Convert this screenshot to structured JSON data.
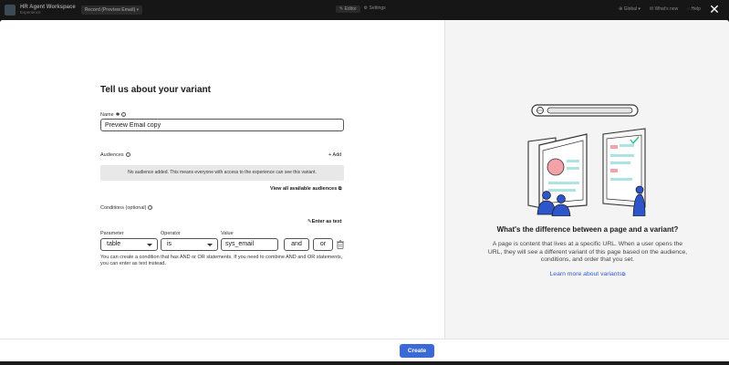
{
  "appbar": {
    "workspace_title": "HR Agent Workspace",
    "workspace_subtitle": "Experience",
    "record_label": "Record (Preview Email)",
    "editor_label": "Editor",
    "settings_label": "Settings",
    "global_label": "Global",
    "whats_new_label": "What's new",
    "help_label": "Help"
  },
  "form": {
    "title": "Tell us about your variant",
    "name_label": "Name",
    "name_value": "Preview Email copy",
    "audiences_label": "Audiences",
    "add_label": "+ Add",
    "no_audience_text": "No audience added. This means everyone with access to the experience can see this variant.",
    "view_audiences_label": "View all available audiences",
    "conditions_label": "Conditions (optional)",
    "enter_as_text_label": "Enter as text",
    "parameter_label": "Parameter",
    "parameter_value": "table",
    "operator_label": "Operator",
    "operator_value": "is",
    "value_label": "Value",
    "value_value": "sys_email",
    "and_label": "and",
    "or_label": "or",
    "help_text": "You can create a condition that has AND or OR statements. If you need to combine AND and OR statements, you can enter as text instead."
  },
  "footer": {
    "create_label": "Create"
  },
  "info_panel": {
    "title": "What's the difference between a page and a variant?",
    "description": "A page is content that lives at a specific URL. When a user opens the URL, they will see a different variant of this page based on the audience, conditions, and order that you set.",
    "link_label": "Learn more about variants"
  },
  "colors": {
    "primary": "#3b6ad6",
    "link": "#2f5cc9",
    "illustration_blue": "#2e55c9",
    "illustration_pink": "#f3a3a8",
    "illustration_teal": "#aee3e6"
  }
}
